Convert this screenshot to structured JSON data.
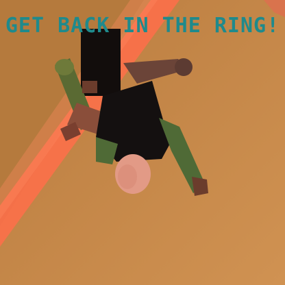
{
  "hud": {
    "message": "GET BACK IN THE RING!"
  },
  "colors": {
    "message_text": "#1f8a8c",
    "ground": "#c58a4a",
    "ground_dark": "#b4783c",
    "ring_edge_glow": "#ff7a55",
    "wall": "#d9734d"
  },
  "character": {
    "icon": "ragdoll-fighter-icon"
  }
}
